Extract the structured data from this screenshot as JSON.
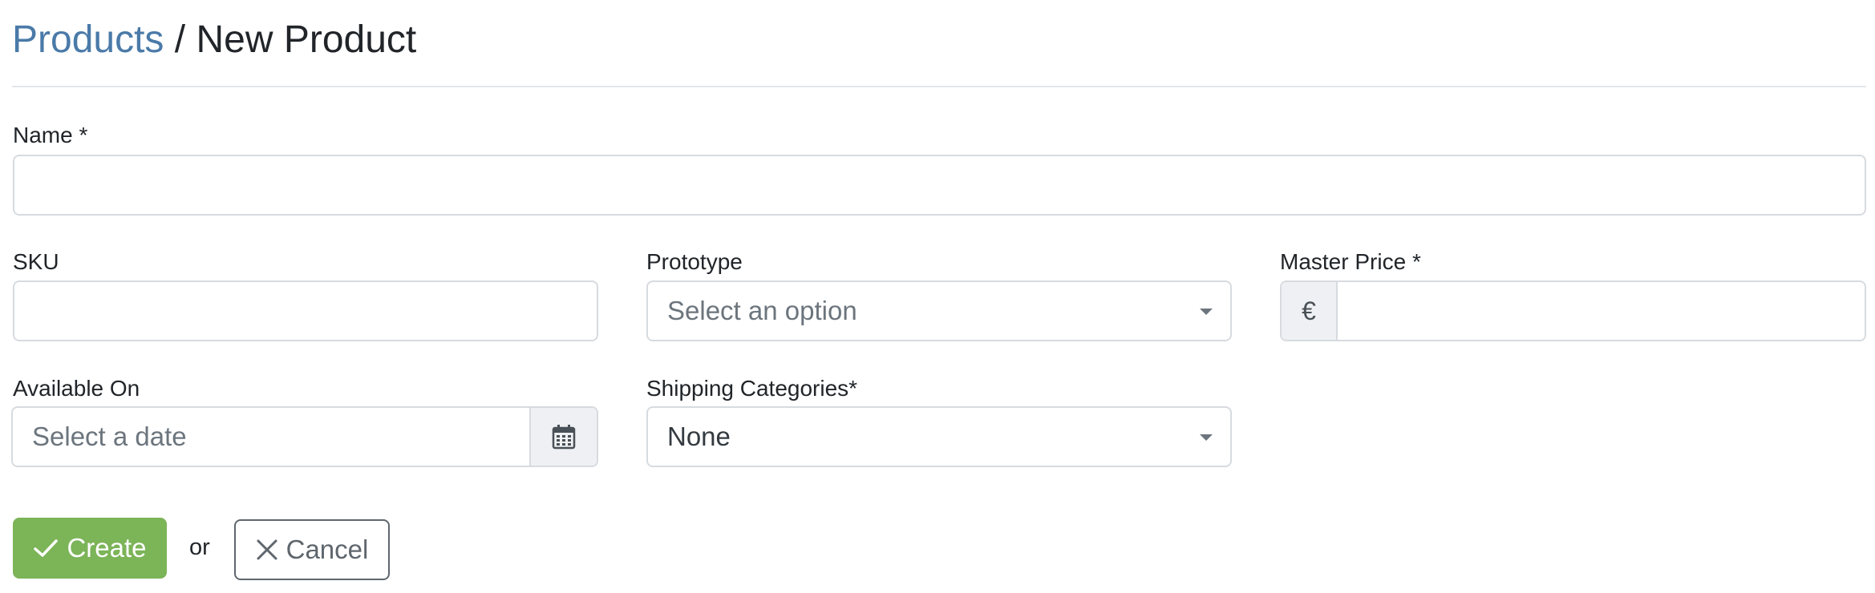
{
  "breadcrumb": {
    "parent": "Products",
    "separator": "/",
    "current": "New Product"
  },
  "form": {
    "name": {
      "label": "Name",
      "required_mark": "*",
      "value": ""
    },
    "sku": {
      "label": "SKU",
      "value": ""
    },
    "prototype": {
      "label": "Prototype",
      "placeholder": "Select an option"
    },
    "master_price": {
      "label": "Master Price",
      "required_mark": "*",
      "currency_symbol": "€",
      "value": ""
    },
    "available_on": {
      "label": "Available On",
      "placeholder": "Select a date"
    },
    "shipping_categories": {
      "label": "Shipping Categories*",
      "selected": "None"
    }
  },
  "actions": {
    "create_label": "Create",
    "or_text": "or",
    "cancel_label": "Cancel"
  },
  "colors": {
    "link": "#4a7aa8",
    "create_button": "#7cb458",
    "cancel_border": "#5f666d",
    "input_border": "#d7dbdf",
    "addon_bg": "#eef0f3"
  },
  "icons": {
    "create": "check-icon",
    "cancel": "close-icon",
    "date": "calendar-icon",
    "select": "chevron-down-icon"
  }
}
